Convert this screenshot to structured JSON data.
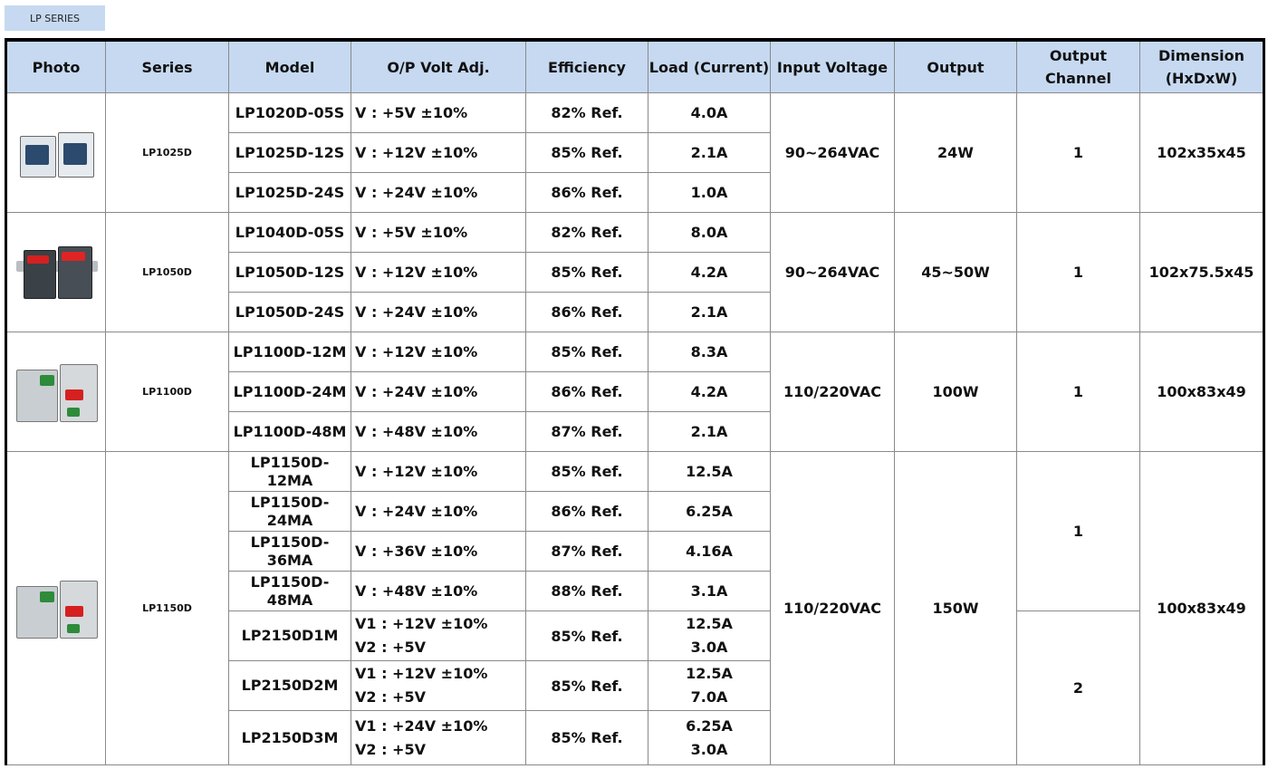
{
  "series_tab": "LP SERIES",
  "headers": {
    "photo": "Photo",
    "series": "Series",
    "model": "Model",
    "op_volt": "O/P Volt Adj.",
    "efficiency": "Efficiency",
    "load": "Load (Current)",
    "input": "Input Voltage",
    "output": "Output",
    "channel_1": "Output",
    "channel_2": "Channel",
    "dimension_1": "Dimension",
    "dimension_2": "(HxDxW)"
  },
  "groups": [
    {
      "series": "LP1025D",
      "input": "90~264VAC",
      "output": "24W",
      "channel": "1",
      "dimension": "102x35x45",
      "photo_icon": "din-rail-psu-white-icon",
      "rows": [
        {
          "model": "LP1020D-05S",
          "volt": "V : +5V ±10%",
          "eff": "82% Ref.",
          "load": "4.0A"
        },
        {
          "model": "LP1025D-12S",
          "volt": "V : +12V ±10%",
          "eff": "85% Ref.",
          "load": "2.1A"
        },
        {
          "model": "LP1025D-24S",
          "volt": "V : +24V ±10%",
          "eff": "86% Ref.",
          "load": "1.0A"
        }
      ]
    },
    {
      "series": "LP1050D",
      "input": "90~264VAC",
      "output": "45~50W",
      "channel": "1",
      "dimension": "102x75.5x45",
      "photo_icon": "din-rail-psu-display-icon",
      "rows": [
        {
          "model": "LP1040D-05S",
          "volt": "V : +5V ±10%",
          "eff": "82% Ref.",
          "load": "8.0A"
        },
        {
          "model": "LP1050D-12S",
          "volt": "V : +12V ±10%",
          "eff": "85% Ref.",
          "load": "4.2A"
        },
        {
          "model": "LP1050D-24S",
          "volt": "V : +24V ±10%",
          "eff": "86% Ref.",
          "load": "2.1A"
        }
      ]
    },
    {
      "series": "LP1100D",
      "input": "110/220VAC",
      "output": "100W",
      "channel": "1",
      "dimension": "100x83x49",
      "photo_icon": "din-rail-psu-large-icon",
      "rows": [
        {
          "model": "LP1100D-12M",
          "volt": "V : +12V ±10%",
          "eff": "85% Ref.",
          "load": "8.3A"
        },
        {
          "model": "LP1100D-24M",
          "volt": "V : +24V ±10%",
          "eff": "86% Ref.",
          "load": "4.2A"
        },
        {
          "model": "LP1100D-48M",
          "volt": "V : +48V ±10%",
          "eff": "87% Ref.",
          "load": "2.1A"
        }
      ]
    },
    {
      "series": "LP1150D",
      "input": "110/220VAC",
      "output": "150W",
      "channel_a": "1",
      "channel_b": "2",
      "dimension": "100x83x49",
      "photo_icon": "din-rail-psu-large-icon",
      "rows": [
        {
          "model_1": "LP1150D-",
          "model_2": "12MA",
          "volt": "V : +12V ±10%",
          "eff": "85% Ref.",
          "load": "12.5A"
        },
        {
          "model_1": "LP1150D-",
          "model_2": "24MA",
          "volt": "V : +24V ±10%",
          "eff": "86% Ref.",
          "load": "6.25A"
        },
        {
          "model_1": "LP1150D-",
          "model_2": "36MA",
          "volt": "V : +36V ±10%",
          "eff": "87% Ref.",
          "load": "4.16A"
        },
        {
          "model_1": "LP1150D-",
          "model_2": "48MA",
          "volt": "V : +48V ±10%",
          "eff": "88% Ref.",
          "load": "3.1A"
        },
        {
          "model": "LP2150D1M",
          "volt_1": "V1 : +12V ±10%",
          "volt_2": "V2 : +5V",
          "eff": "85% Ref.",
          "load_1": "12.5A",
          "load_2": "3.0A"
        },
        {
          "model": "LP2150D2M",
          "volt_1": "V1 : +12V ±10%",
          "volt_2": "V2 : +5V",
          "eff": "85% Ref.",
          "load_1": "12.5A",
          "load_2": "7.0A"
        },
        {
          "model": "LP2150D3M",
          "volt_1": "V1 : +24V ±10%",
          "volt_2": "V2 : +5V",
          "eff": "85% Ref.",
          "load_1": "6.25A",
          "load_2": "3.0A"
        }
      ]
    }
  ]
}
